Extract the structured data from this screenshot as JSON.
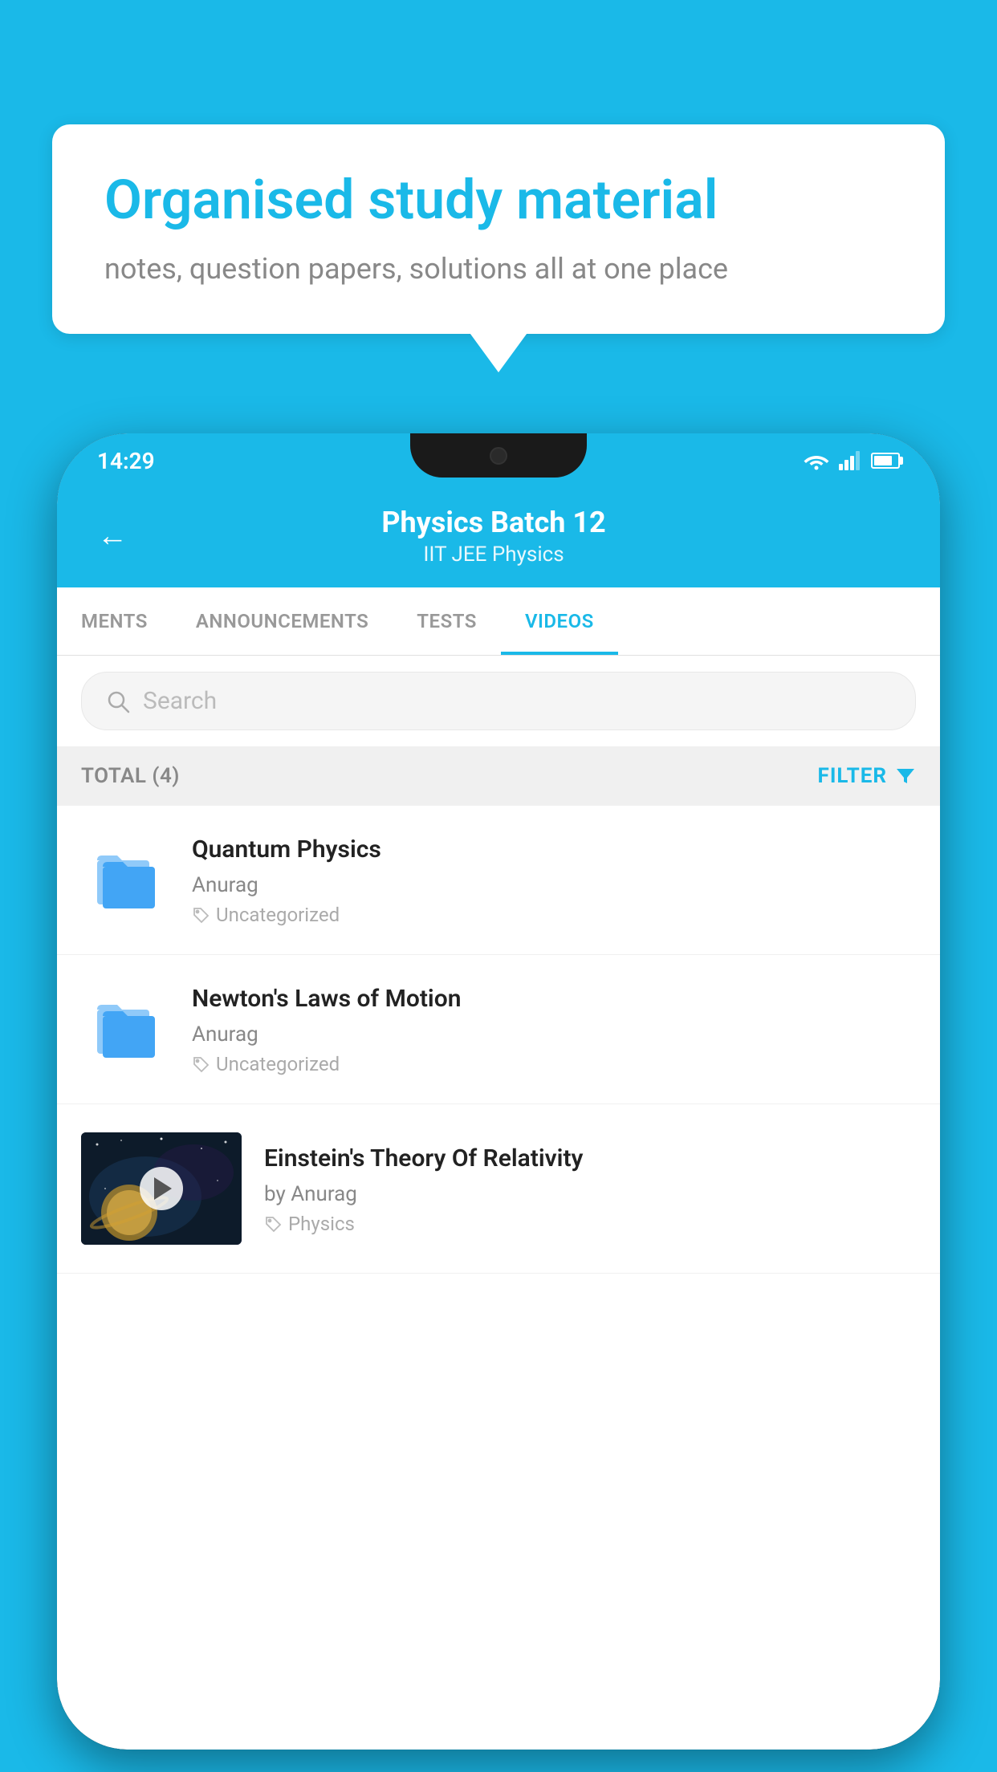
{
  "background_color": "#1ab9e8",
  "bubble": {
    "title": "Organised study material",
    "subtitle": "notes, question papers, solutions all at one place"
  },
  "status_bar": {
    "time": "14:29"
  },
  "app_header": {
    "title": "Physics Batch 12",
    "subtitle": "IIT JEE   Physics",
    "back_label": "←"
  },
  "tabs": [
    {
      "label": "MENTS",
      "active": false
    },
    {
      "label": "ANNOUNCEMENTS",
      "active": false
    },
    {
      "label": "TESTS",
      "active": false
    },
    {
      "label": "VIDEOS",
      "active": true
    }
  ],
  "search": {
    "placeholder": "Search"
  },
  "filter_bar": {
    "total_label": "TOTAL (4)",
    "filter_label": "FILTER"
  },
  "videos": [
    {
      "title": "Quantum Physics",
      "author": "Anurag",
      "tag": "Uncategorized",
      "has_thumb": false
    },
    {
      "title": "Newton's Laws of Motion",
      "author": "Anurag",
      "tag": "Uncategorized",
      "has_thumb": false
    },
    {
      "title": "Einstein's Theory Of Relativity",
      "author": "by Anurag",
      "tag": "Physics",
      "has_thumb": true
    }
  ]
}
